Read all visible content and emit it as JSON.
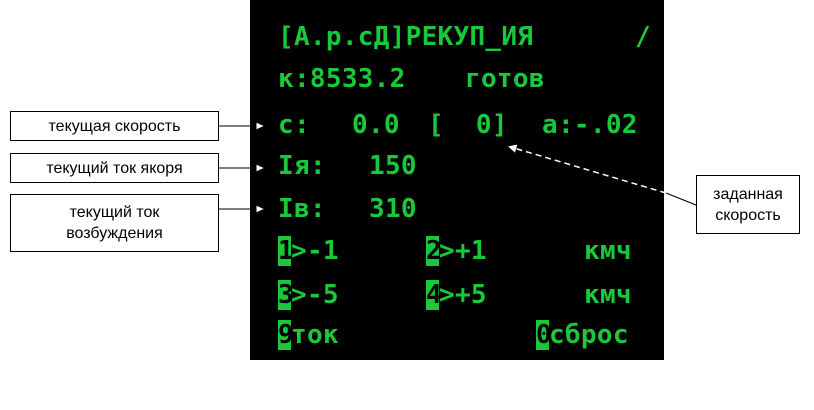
{
  "colors": {
    "screen_text": "#19c93a",
    "screen_bg": "#000000",
    "label_border": "#000000"
  },
  "screen": {
    "title": "[А.р.сД]РЕКУП_ИЯ",
    "title_slash": "/",
    "status_left": "к:8533.2",
    "status_right": "готов",
    "speed_label": "с:",
    "speed_value": "0.0",
    "speed_set": "[  0]",
    "accel": "а:-.02",
    "armature_label": "Iя:",
    "armature_value": "150",
    "field_label": "Iв:",
    "field_value": "310",
    "keys": [
      {
        "key": "1",
        "action": ">-1"
      },
      {
        "key": "2",
        "action": ">+1"
      },
      {
        "key": "3",
        "action": ">-5"
      },
      {
        "key": "4",
        "action": ">+5"
      },
      {
        "key": "9",
        "action": "ток"
      },
      {
        "key": "0",
        "action": "сброс"
      }
    ],
    "unit_row1": "кмч",
    "unit_row2": "кмч"
  },
  "labels": {
    "current_speed": "текущая скорость",
    "armature_current": "текущий ток якоря",
    "field_current": "текущий ток возбуждения",
    "set_speed": "заданная скорость"
  }
}
